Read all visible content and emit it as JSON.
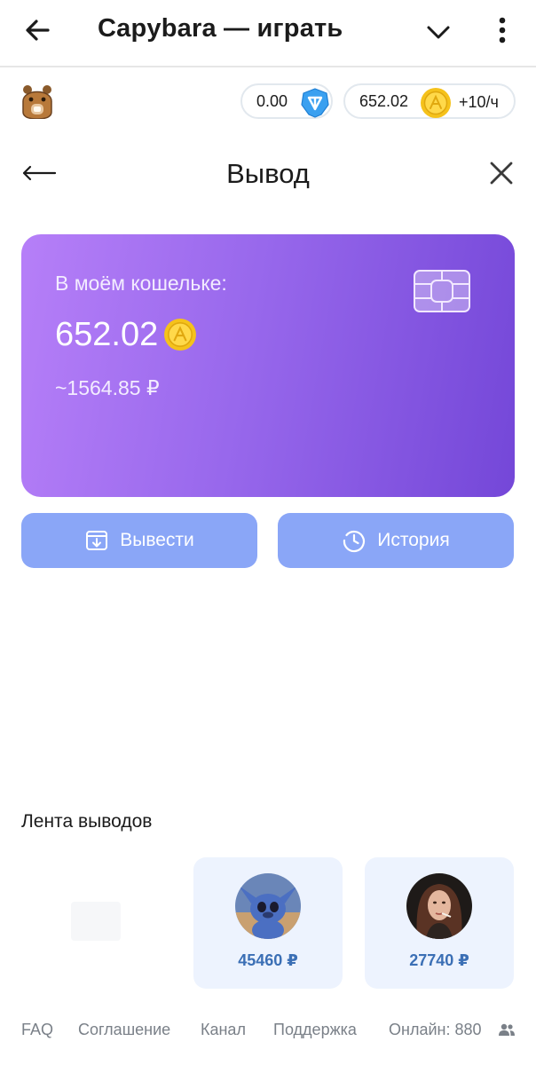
{
  "topbar": {
    "title": "Capybara — играть"
  },
  "balances": {
    "ton": "0.00",
    "coins": "652.02",
    "rate": "+10/ч"
  },
  "withdraw": {
    "title": "Вывод"
  },
  "card": {
    "label": "В моём кошельке:",
    "amount": "652.02",
    "rub": "~1564.85 ₽"
  },
  "buttons": {
    "withdraw": "Вывести",
    "history": "История"
  },
  "feed": {
    "title": "Лента выводов",
    "items": [
      {
        "amount": "45460 ₽"
      },
      {
        "amount": "27740 ₽"
      }
    ]
  },
  "footer": {
    "faq": "FAQ",
    "agreement": "Соглашение",
    "channel": "Канал",
    "support": "Поддержка",
    "online": "Онлайн: 880"
  },
  "colors": {
    "card_gradient_start": "#b67ff8",
    "card_gradient_end": "#7447d8",
    "button": "#8aa6f7",
    "feed_card": "#edf3fe",
    "feed_amount": "#3b6fb5"
  }
}
